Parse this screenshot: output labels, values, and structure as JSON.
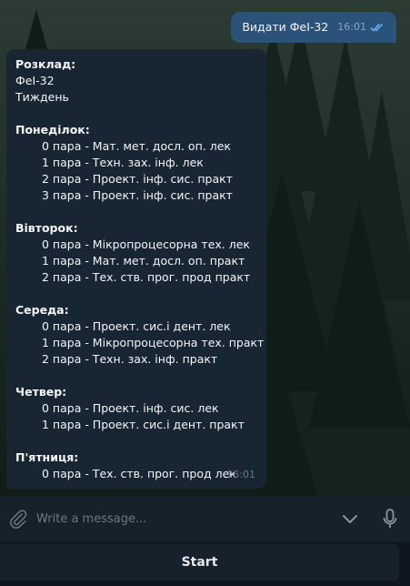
{
  "outgoing": {
    "text": "Видати ФеІ-32",
    "time": "16:01"
  },
  "incoming": {
    "time": "16:01",
    "lines": [
      {
        "text": "Розклад:",
        "bold": true,
        "indent": false
      },
      {
        "text": "ФеІ-32",
        "bold": false,
        "indent": false
      },
      {
        "text": "Тиждень",
        "bold": false,
        "indent": false
      },
      {
        "text": "",
        "bold": false,
        "indent": false
      },
      {
        "text": "Понеділок:",
        "bold": true,
        "indent": false
      },
      {
        "text": "0 пара - Мат. мет. досл. оп. лек",
        "bold": false,
        "indent": true
      },
      {
        "text": "1 пара - Техн. зах. інф. лек",
        "bold": false,
        "indent": true
      },
      {
        "text": "2 пара - Проект. інф. сис. практ",
        "bold": false,
        "indent": true
      },
      {
        "text": "3 пара - Проект. інф. сис. практ",
        "bold": false,
        "indent": true
      },
      {
        "text": "",
        "bold": false,
        "indent": false
      },
      {
        "text": "Вівторок:",
        "bold": true,
        "indent": false
      },
      {
        "text": "0 пара - Мікропроцесорна тех. лек",
        "bold": false,
        "indent": true
      },
      {
        "text": "1 пара - Мат. мет. досл. оп. практ",
        "bold": false,
        "indent": true
      },
      {
        "text": "2 пара - Тех. ств. прог. прод практ",
        "bold": false,
        "indent": true
      },
      {
        "text": "",
        "bold": false,
        "indent": false
      },
      {
        "text": "Середа:",
        "bold": true,
        "indent": false
      },
      {
        "text": "0 пара - Проект. сис.і дент. лек",
        "bold": false,
        "indent": true
      },
      {
        "text": "1 пара - Мікропроцесорна тех. практ",
        "bold": false,
        "indent": true
      },
      {
        "text": "2 пара - Техн. зах. інф. практ",
        "bold": false,
        "indent": true
      },
      {
        "text": "",
        "bold": false,
        "indent": false
      },
      {
        "text": "Четвер:",
        "bold": true,
        "indent": false
      },
      {
        "text": "0 пара - Проект. інф. сис. лек",
        "bold": false,
        "indent": true
      },
      {
        "text": "1 пара - Проект. сис.і дент. практ",
        "bold": false,
        "indent": true
      },
      {
        "text": "",
        "bold": false,
        "indent": false
      },
      {
        "text": "П'ятниця:",
        "bold": true,
        "indent": false
      },
      {
        "text": "0 пара - Тех. ств. прог. прод лек",
        "bold": false,
        "indent": true
      }
    ]
  },
  "composer": {
    "placeholder": "Write a message...",
    "icons": {
      "attach": "paperclip-icon",
      "keyboard": "chevron-down-icon",
      "voice": "microphone-icon"
    }
  },
  "start_button": {
    "label": "Start"
  },
  "colors": {
    "outgoing_bubble": "#2b5278",
    "incoming_bubble": "#182533",
    "composer_bg": "#17212b",
    "read_check": "#6fb3ff"
  }
}
